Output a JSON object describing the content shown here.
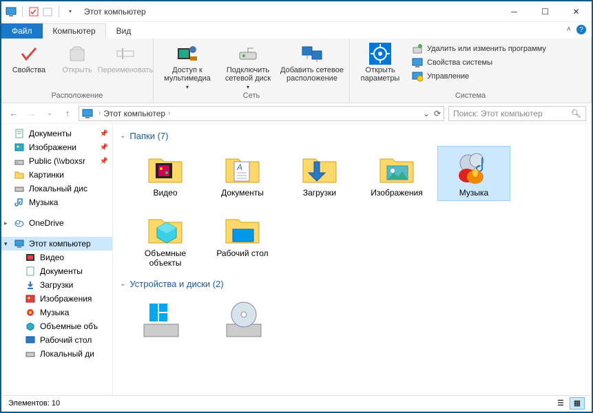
{
  "window": {
    "title": "Этот компьютер"
  },
  "tabs": {
    "file": "Файл",
    "computer": "Компьютер",
    "view": "Вид"
  },
  "ribbon": {
    "group_location": {
      "title": "Расположение",
      "properties": "Свойства",
      "open": "Открыть",
      "rename": "Переименовать"
    },
    "group_network": {
      "title": "Сеть",
      "media": "Доступ к мультимедиа",
      "map_drive": "Подключить сетевой диск",
      "add_location": "Добавить сетевое расположение"
    },
    "group_system": {
      "title": "Система",
      "open_settings": "Открыть параметры",
      "uninstall": "Удалить или изменить программу",
      "sys_props": "Свойства системы",
      "manage": "Управление"
    }
  },
  "address": {
    "path": "Этот компьютер",
    "search_placeholder": "Поиск: Этот компьютер"
  },
  "tree": {
    "quick": [
      {
        "label": "Документы",
        "icon": "doc",
        "pinned": true
      },
      {
        "label": "Изображени",
        "icon": "img",
        "pinned": true
      },
      {
        "label": "Public (\\\\vboxsr",
        "icon": "net",
        "pinned": true
      },
      {
        "label": "Картинки",
        "icon": "folder",
        "pinned": false
      },
      {
        "label": "Локальный дис",
        "icon": "drive",
        "pinned": false
      },
      {
        "label": "Музыка",
        "icon": "music",
        "pinned": false
      }
    ],
    "onedrive": "OneDrive",
    "thispc": "Этот компьютер",
    "pc_children": [
      {
        "label": "Видео",
        "icon": "video"
      },
      {
        "label": "Документы",
        "icon": "doc"
      },
      {
        "label": "Загрузки",
        "icon": "down"
      },
      {
        "label": "Изображения",
        "icon": "img2"
      },
      {
        "label": "Музыка",
        "icon": "music2"
      },
      {
        "label": "Объемные объ",
        "icon": "3d"
      },
      {
        "label": "Рабочий стол",
        "icon": "desk"
      },
      {
        "label": "Локальный ди",
        "icon": "drive"
      }
    ]
  },
  "content": {
    "folders_header": "Папки (7)",
    "folders": [
      {
        "label": "Видео",
        "kind": "video"
      },
      {
        "label": "Документы",
        "kind": "doc"
      },
      {
        "label": "Загрузки",
        "kind": "down"
      },
      {
        "label": "Изображения",
        "kind": "img"
      },
      {
        "label": "Музыка",
        "kind": "music",
        "selected": true
      },
      {
        "label": "Объемные объекты",
        "kind": "3d"
      },
      {
        "label": "Рабочий стол",
        "kind": "desk"
      }
    ],
    "devices_header": "Устройства и диски (2)"
  },
  "status": {
    "text": "Элементов: 10"
  }
}
